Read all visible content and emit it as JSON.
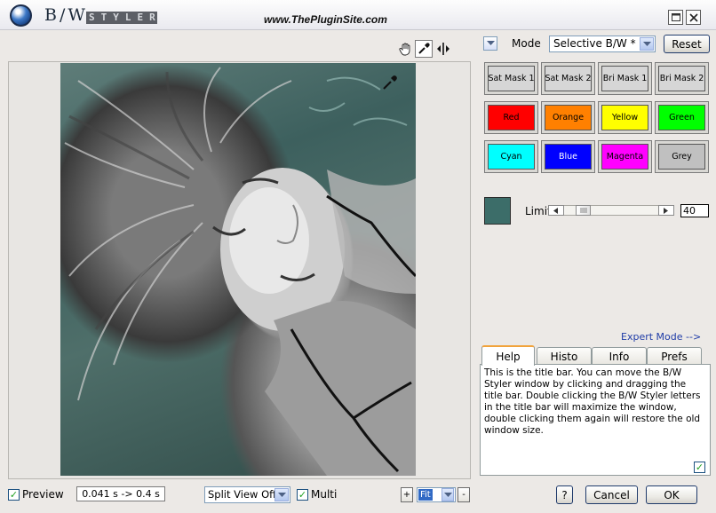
{
  "titlebar": {
    "brand_bw": "B/W",
    "brand_styler": "STYLER",
    "site_url": "www.ThePluginSite.com",
    "maximize_icon": "maximize-icon",
    "close_icon": "close-icon"
  },
  "tools": [
    "hand-icon",
    "eyedropper-icon",
    "compare-icon"
  ],
  "mode": {
    "label": "Mode",
    "selected": "Selective B/W *",
    "reset_label": "Reset"
  },
  "swatches": [
    {
      "label": "Sat Mask 1",
      "color": "#d6d6d6"
    },
    {
      "label": "Sat Mask 2",
      "color": "#d6d6d6"
    },
    {
      "label": "Bri Mask 1",
      "color": "#d6d6d6"
    },
    {
      "label": "Bri Mask 2",
      "color": "#d6d6d6"
    },
    {
      "label": "Red",
      "color": "#ff0000"
    },
    {
      "label": "Orange",
      "color": "#ff8000"
    },
    {
      "label": "Yellow",
      "color": "#ffff00"
    },
    {
      "label": "Green",
      "color": "#00ff00"
    },
    {
      "label": "Cyan",
      "color": "#00ffff"
    },
    {
      "label": "Blue",
      "color": "#0000ff"
    },
    {
      "label": "Magenta",
      "color": "#ff00ff"
    },
    {
      "label": "Grey",
      "color": "#c0c0c0"
    }
  ],
  "limit": {
    "label": "Limit",
    "value": "40",
    "swatch_color": "#3c6d69",
    "level": 0.3
  },
  "expert_mode": "Expert Mode -->",
  "tabs": [
    {
      "label": "Help",
      "active": true
    },
    {
      "label": "Histo"
    },
    {
      "label": "Info"
    },
    {
      "label": "Prefs"
    }
  ],
  "help_text": "This is the title bar. You can move the B/W Styler window by clicking and dragging the title bar. Double clicking the B/W Styler letters in the title bar will maximize the window, double clicking them again will restore the old window size.",
  "bottom": {
    "preview_label": "Preview",
    "preview_checked": true,
    "timing": "0.041 s -> 0.4 s",
    "split_view": "Split View Off",
    "multi_label": "Multi",
    "multi_checked": true,
    "zoom_in": "+",
    "zoom_value": "Fit",
    "zoom_out": "-",
    "help_button": "?",
    "cancel_button": "Cancel",
    "ok_button": "OK"
  }
}
